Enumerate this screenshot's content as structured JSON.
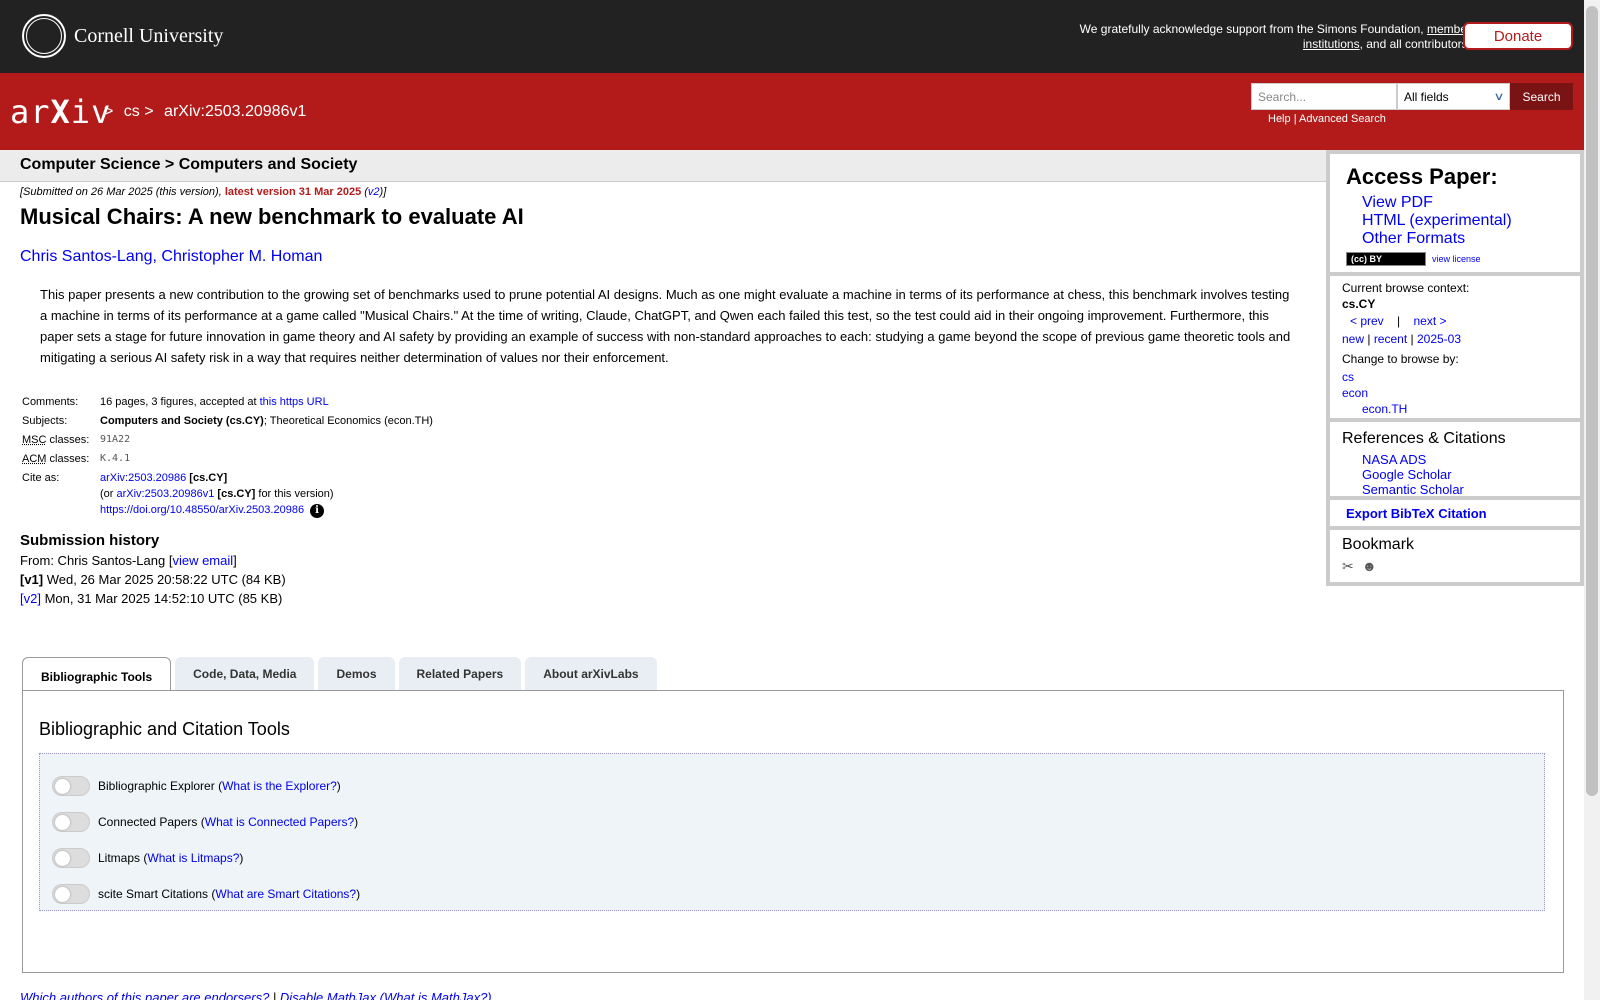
{
  "banner": {
    "university": "Cornell University",
    "support_prefix": "We gratefully acknowledge support from the Simons Foundation,",
    "support_link": "member institutions",
    "support_suffix": ", and all contributors.",
    "donate_label": "Donate"
  },
  "header": {
    "logo_a": "ar",
    "logo_x": "X",
    "logo_b": "iv",
    "crumbs": [
      ">",
      "cs",
      ">",
      "arXiv:2503.20986v1"
    ],
    "search_placeholder": "Search...",
    "field_value": "All fields",
    "search_label": "Search",
    "help": "Help",
    "sep": "|",
    "advanced": "Advanced Search"
  },
  "subheader": "Computer Science > Computers and Society",
  "paper": {
    "submitted_prefix": "[Submitted on 26 Mar 2025 (this version),",
    "latest": "latest version 31 Mar 2025",
    "v2_open": "(",
    "v2": "v2",
    "v2_close": ")]",
    "title": "Musical Chairs: A new benchmark to evaluate AI",
    "author1": "Chris Santos-Lang,",
    "author2": "Christopher M. Homan",
    "abstract": "This paper presents a new contribution to the growing set of benchmarks used to prune potential AI designs. Much as one might evaluate a machine in terms of its performance at chess, this benchmark involves testing a machine in terms of its performance at a game called \"Musical Chairs.\" At the time of writing, Claude, ChatGPT, and Qwen each failed this test, so the test could aid in their ongoing improvement. Furthermore, this paper sets a stage for future innovation in game theory and AI safety by providing an example of success with non-standard approaches to each: studying a game beyond the scope of previous game theoretic tools and mitigating a serious AI safety risk in a way that requires neither determination of values nor their enforcement."
  },
  "meta": {
    "comments_label": "Comments:",
    "comments_text": "16 pages, 3 figures, accepted at ",
    "comments_link": "this https URL",
    "subjects_label": "Subjects:",
    "subjects_bold": "Computers and Society (cs.CY)",
    "subjects_rest": "; Theoretical Economics (econ.TH)",
    "msc_abbr": "MSC",
    "classes": " classes:",
    "msc_val": "91A22",
    "acm_abbr": "ACM",
    "acm_val": "K.4.1",
    "cite_label": "Cite as:",
    "cite_link": "arXiv:2503.20986",
    "cite_tag": " [cs.CY]",
    "cite2_pre": "(or ",
    "cite2_link": "arXiv:2503.20986v1",
    "cite2_tag": " [cs.CY]",
    "cite2_post": " for this version)",
    "doi": "https://doi.org/10.48550/arXiv.2503.20986",
    "info_glyph": "i"
  },
  "history": {
    "title": "Submission history",
    "from": "From: Chris Santos-Lang [",
    "view_email": "view email",
    "close": "]",
    "v1_tag": "[v1]",
    "v1_text": " Wed, 26 Mar 2025 20:58:22 UTC (84 KB)",
    "v2_tag": "[v2]",
    "v2_text": " Mon, 31 Mar 2025 14:52:10 UTC (85 KB)"
  },
  "tabs": [
    "Bibliographic Tools",
    "Code, Data, Media",
    "Demos",
    "Related Papers",
    "About arXivLabs"
  ],
  "panel": {
    "title": "Bibliographic and Citation Tools",
    "tools": [
      {
        "name": "Bibliographic Explorer",
        "link": "What is the Explorer?"
      },
      {
        "name": "Connected Papers",
        "link": "What is Connected Papers?"
      },
      {
        "name": "Litmaps",
        "link": "What is Litmaps?"
      },
      {
        "name": "scite Smart Citations",
        "link": "What are Smart Citations?"
      }
    ]
  },
  "bottom": {
    "endorsers": "Which authors of this paper are endorsers?",
    "sep": " | ",
    "mathjax": "Disable MathJax",
    "mathjax_what": "(What is MathJax?)"
  },
  "sidebar": {
    "access_title": "Access Paper:",
    "view_pdf": "View PDF",
    "html": "HTML (experimental)",
    "other": "Other Formats",
    "cc": "(cc) BY",
    "view_license": "view license",
    "context_label": "Current browse context:",
    "context": "cs.CY",
    "prev": "< prev",
    "bar": "|",
    "next": "next >",
    "new": "new",
    "recent": "recent",
    "month": "2025-03",
    "change": "Change to browse by:",
    "browse": [
      "cs",
      "econ",
      "econ.TH"
    ],
    "refs_title": "References & Citations",
    "refs": [
      "NASA ADS",
      "Google Scholar",
      "Semantic Scholar"
    ],
    "bibtex": "Export BibTeX Citation",
    "bookmark": "Bookmark"
  }
}
